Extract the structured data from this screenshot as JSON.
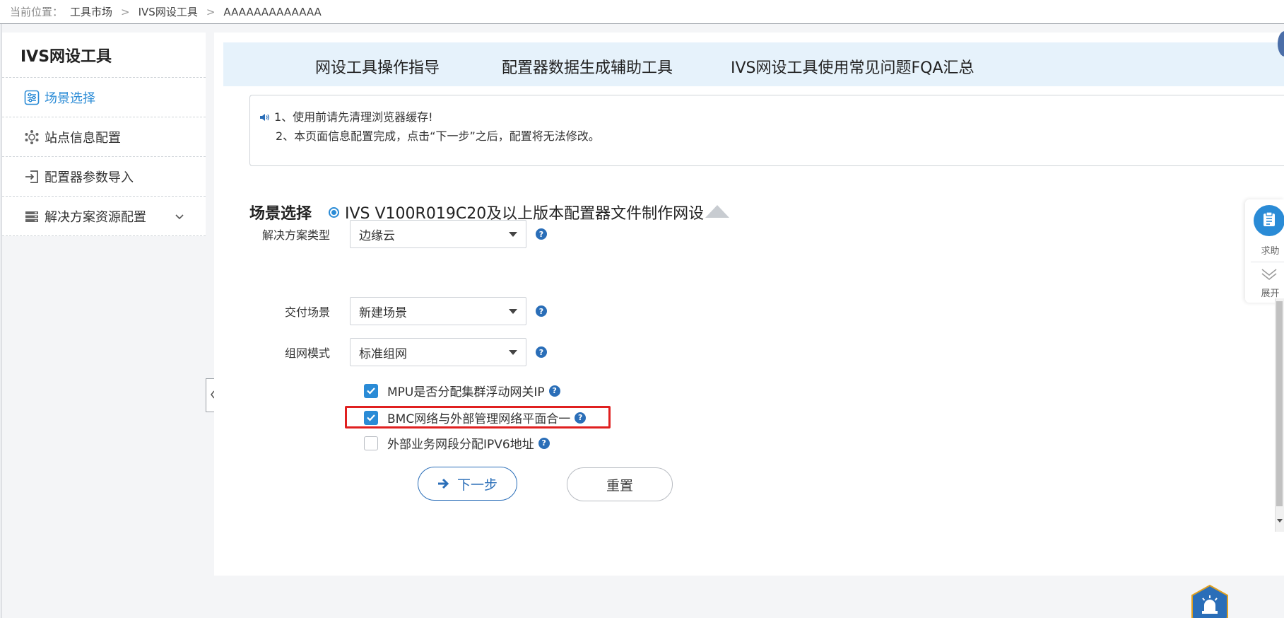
{
  "breadcrumb": {
    "prefix": "当前位置：",
    "items": [
      "工具市场",
      "IVS网设工具",
      "AAAAAAAAAAAAA"
    ],
    "separator": ">"
  },
  "sidebar": {
    "title": "IVS网设工具",
    "items": [
      {
        "label": "场景选择",
        "icon": "sliders-icon",
        "active": true
      },
      {
        "label": "站点信息配置",
        "icon": "network-nodes-icon",
        "active": false
      },
      {
        "label": "配置器参数导入",
        "icon": "import-icon",
        "active": false
      },
      {
        "label": "解决方案资源配置",
        "icon": "server-stack-icon",
        "active": false,
        "expandable": true
      }
    ]
  },
  "tabs": [
    {
      "label": "网设工具操作指导"
    },
    {
      "label": "配置器数据生成辅助工具"
    },
    {
      "label": "IVS网设工具使用常见问题FQA汇总"
    }
  ],
  "notice": {
    "line1": "1、使用前请先清理浏览器缓存!",
    "line2": "2、本页面信息配置完成，点击“下一步”之后，配置将无法修改。"
  },
  "scene": {
    "label": "场景选择",
    "option": "IVS V100R019C20及以上版本配置器文件制作网设"
  },
  "form": {
    "solution_type": {
      "label": "解决方案类型",
      "value": "边缘云"
    },
    "delivery_scene": {
      "label": "交付场景",
      "value": "新建场景"
    },
    "network_mode": {
      "label": "组网模式",
      "value": "标准组网"
    }
  },
  "checks": [
    {
      "label": "MPU是否分配集群浮动网关IP",
      "checked": true
    },
    {
      "label": "BMC网络与外部管理网络平面合一",
      "checked": true
    },
    {
      "label": "外部业务网段分配IPV6地址",
      "checked": false
    }
  ],
  "help_glyph": "?",
  "buttons": {
    "next": "下一步",
    "reset": "重置"
  },
  "float_widget": {
    "help_label": "求助",
    "expand_label": "展开"
  },
  "colors": {
    "accent": "#2a8bd6",
    "help_icon": "#2a6eb8",
    "highlight": "#e02020",
    "tab_bar": "#e6f2fb"
  }
}
